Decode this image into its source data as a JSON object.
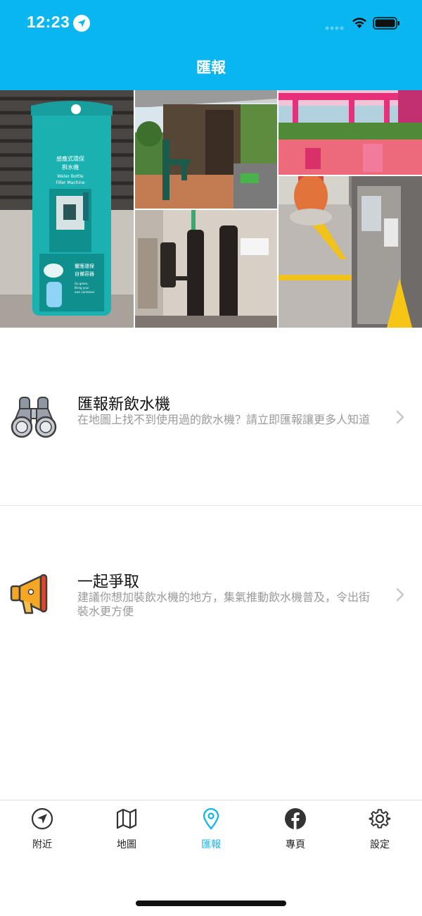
{
  "status_bar": {
    "time": "12:23"
  },
  "header": {
    "title": "匯報"
  },
  "actions": [
    {
      "title": "匯報新飲水機",
      "description": "在地圖上找不到使用過的飲水機？請立即匯報讓更多人知道",
      "icon": "binoculars-icon"
    },
    {
      "title": "一起爭取",
      "description": "建議你想加裝飲水機的地方，集氣推動飲水機普及，令出街裝水更方便",
      "icon": "megaphone-icon"
    }
  ],
  "tabs": [
    {
      "label": "附近",
      "icon": "navigation-icon",
      "active": false
    },
    {
      "label": "地圖",
      "icon": "map-icon",
      "active": false
    },
    {
      "label": "匯報",
      "icon": "location-pin-icon",
      "active": true
    },
    {
      "label": "專頁",
      "icon": "facebook-icon",
      "active": false
    },
    {
      "label": "設定",
      "icon": "gear-icon",
      "active": false
    }
  ],
  "colors": {
    "accent": "#0AB6EF",
    "machine_teal": "#1BB1B0",
    "pavilion_pink": "#E8307A"
  },
  "photo_text": {
    "machine_title": "感應式環保\n斟水機",
    "machine_en": "Water Bottle\nFiller Machine",
    "machine_slogan": "響應環保\n自備容器",
    "machine_slogan_en": "Go green,\nBring your\nown container"
  }
}
